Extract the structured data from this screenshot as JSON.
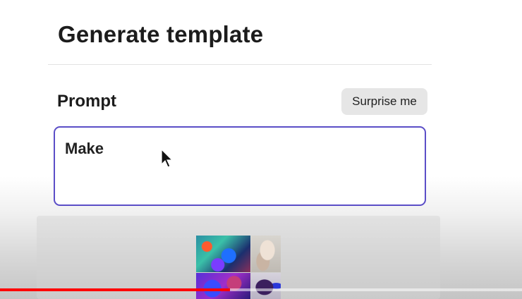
{
  "panel": {
    "title": "Generate template",
    "prompt_label": "Prompt",
    "surprise_button_label": "Surprise me",
    "prompt_value": "Make",
    "accent_color": "#5b4ec7"
  },
  "preview": {
    "thumbnails": [
      "graffiti-art-thumbnail",
      "portrait-thumbnail",
      "purple-abstract-thumbnail",
      "fashion-thumbnail"
    ]
  },
  "video_player": {
    "progress_fraction": 0.44,
    "progress_color": "#ff0000"
  },
  "icons": {
    "cursor": "mouse-pointer-icon"
  }
}
